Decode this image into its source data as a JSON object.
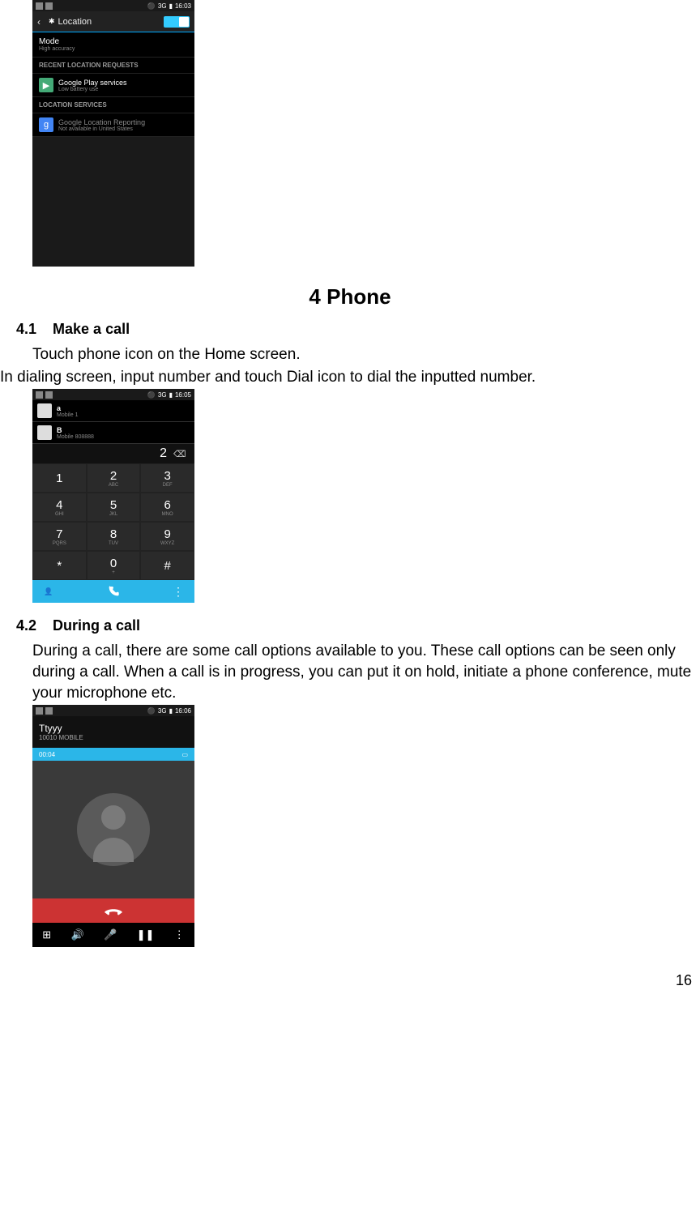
{
  "page_number": "16",
  "section_title": "4   Phone",
  "s41": {
    "num": "4.1",
    "title": "Make a call"
  },
  "s41_p1": "Touch phone icon on the Home screen.",
  "s41_p2": "In dialing screen, input number and touch Dial icon to dial the inputted number.",
  "s42": {
    "num": "4.2",
    "title": "During a call"
  },
  "s42_p1": "During a call, there are some call options available to you. These call options can be seen only during a call. When a call is in progress, you can put it on hold, initiate a phone conference, mute your microphone etc.",
  "shot1": {
    "time": "16:03",
    "net": "3G",
    "title": "Location",
    "mode_label": "Mode",
    "mode_value": "High accuracy",
    "recent_head": "RECENT LOCATION REQUESTS",
    "gps_label": "Google Play services",
    "gps_sub": "Low battery use",
    "services_head": "LOCATION SERVICES",
    "glr_label": "Google Location Reporting",
    "glr_sub": "Not available in United States"
  },
  "shot2": {
    "time": "16:05",
    "net": "3G",
    "contact_a": "a",
    "contact_a_sub": "Mobile 1",
    "contact_b": "B",
    "contact_b_sub": "Mobile 808888",
    "input": "2",
    "keys": [
      "1",
      "2",
      "3",
      "4",
      "5",
      "6",
      "7",
      "8",
      "9",
      "*",
      "0",
      "#"
    ],
    "subs": [
      "",
      "ABC",
      "DEF",
      "GHI",
      "JKL",
      "MNO",
      "PQRS",
      "TUV",
      "WXYZ",
      "",
      "+",
      ""
    ]
  },
  "shot3": {
    "time": "16:06",
    "net": "3G",
    "name": "Ttyyy",
    "number": "10010  MOBILE",
    "timer": "00:04"
  }
}
